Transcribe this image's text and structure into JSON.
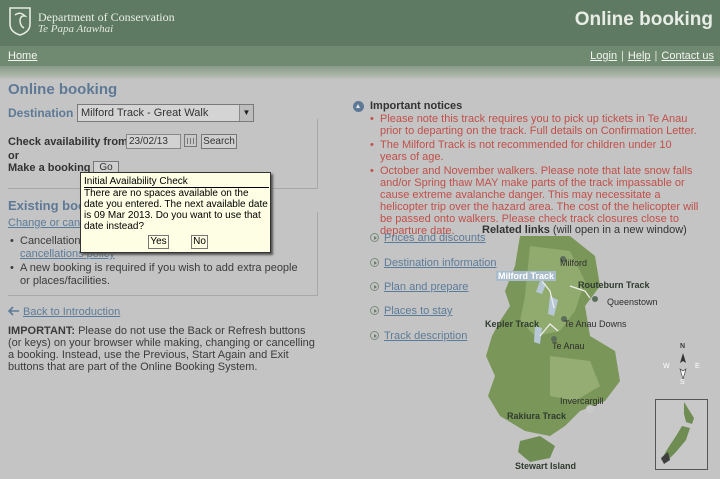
{
  "header": {
    "org_name": "Department of Conservation",
    "org_maori": "Te Papa Atawhai",
    "title": "Online booking"
  },
  "nav": {
    "home": "Home",
    "login": "Login",
    "help": "Help",
    "contact": "Contact us",
    "separator": "|"
  },
  "main": {
    "title": "Online booking",
    "destination_label": "Destination",
    "destination_value": "Milford Track - Great Walk",
    "check_label": "Check availability from",
    "date_value": "23/02/13",
    "search_label": "Search",
    "or_label": "or",
    "make_booking_label": "Make a booking",
    "go_label": "Go",
    "existing_title": "Existing bookings",
    "change_link": "Change or cancel a booking",
    "bullet1_text": "Cancellation fees apply, see",
    "bullet1_link": "cancellations policy",
    "bullet2": "A new booking is required if you wish to add extra people or places/facilities.",
    "back_link": "Back to Introduction",
    "important_label": "IMPORTANT:",
    "important_text": " Please do not use the Back or Refresh buttons (or keys) on your browser while making, changing or cancelling a booking. Instead, use the Previous, Start Again and Exit buttons that are part of the Online Booking System."
  },
  "notices": {
    "title": "Important notices",
    "items": [
      "Please note this track requires you to pick up tickets in Te Anau prior to departing on the track. Full details on Confirmation Letter.",
      "The Milford Track is not recommended for children under 10 years of age.",
      "October and November walkers. Please note that late snow falls and/or Spring thaw MAY make parts of the track impassable or cause extreme avalanche danger. This may necessitate a helicopter trip over the hazard area. The cost of the helicopter will be passed onto walkers. Please check track closures close to departure date."
    ]
  },
  "related": {
    "title_bold": "Related links",
    "title_rest": " (will open in a new window)",
    "links": [
      "Prices and discounts",
      "Destination information",
      "Plan and prepare",
      "Places to stay",
      "Track description"
    ]
  },
  "map": {
    "labels": {
      "milford_sound": "Milford",
      "milford_track": "Milford Track",
      "routeburn": "Routeburn Track",
      "queenstown": "Queenstown",
      "kepler": "Kepler Track",
      "te_anau_downs": "Te Anau Downs",
      "te_anau": "Te Anau",
      "invercargill": "Invercargill",
      "rakiura": "Rakiura Track",
      "stewart_island": "Stewart Island"
    },
    "compass": {
      "n": "N",
      "s": "S",
      "e": "E",
      "w": "W"
    },
    "colors": {
      "land": "#6f8d52",
      "land_light": "#9ab27a",
      "water": "#c9c9c9",
      "highlight": "#a9bccc"
    }
  },
  "dialog": {
    "title": "Initial Availability Check",
    "message": "There are no spaces available on the date you entered. The next available date is 09 Mar 2013. Do you want to use that date instead?",
    "yes": "Yes",
    "no": "No"
  },
  "colors": {
    "header": "#5f7a63",
    "heading_blue": "#5e7996",
    "notice_red": "#c0504a",
    "link": "#5c7b99",
    "dialog_bg": "#fdfee4"
  }
}
